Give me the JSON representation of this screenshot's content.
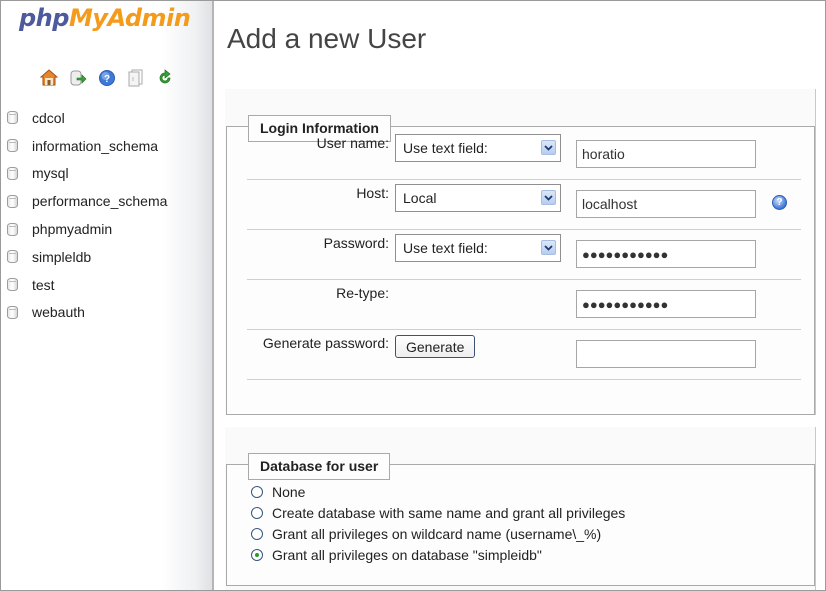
{
  "app": {
    "logo_part1": "php",
    "logo_part2": "MyAdmin"
  },
  "sidebar": {
    "toolbar_icons": [
      {
        "name": "home-icon"
      },
      {
        "name": "logout-icon"
      },
      {
        "name": "help-icon"
      },
      {
        "name": "documentation-icon"
      },
      {
        "name": "reload-icon"
      }
    ],
    "databases": [
      {
        "label": "cdcol"
      },
      {
        "label": "information_schema"
      },
      {
        "label": "mysql"
      },
      {
        "label": "performance_schema"
      },
      {
        "label": "phpmyadmin"
      },
      {
        "label": "simpleldb"
      },
      {
        "label": "test"
      },
      {
        "label": "webauth"
      }
    ]
  },
  "main": {
    "title": "Add a new User",
    "login_information": {
      "legend": "Login Information",
      "user_name": {
        "label": "User name:",
        "select": "Use text field:",
        "value": "horatio"
      },
      "host": {
        "label": "Host:",
        "select": "Local",
        "value": "localhost"
      },
      "password": {
        "label": "Password:",
        "select": "Use text field:",
        "value": "●●●●●●●●●●●"
      },
      "retype": {
        "label": "Re-type:",
        "value": "●●●●●●●●●●●"
      },
      "generate": {
        "label": "Generate password:",
        "button": "Generate",
        "value": ""
      }
    },
    "database_for_user": {
      "legend": "Database for user",
      "options": [
        {
          "label": "None",
          "selected": false
        },
        {
          "label": "Create database with same name and grant all privileges",
          "selected": false
        },
        {
          "label": "Grant all privileges on wildcard name (username\\_%)",
          "selected": false
        },
        {
          "label": "Grant all privileges on database \"simpleidb\"",
          "selected": true
        }
      ]
    }
  },
  "colors": {
    "logo_php": "#4d5a9c",
    "logo_myadmin": "#f49b1b",
    "radio_selected": "#2c9a2c"
  }
}
